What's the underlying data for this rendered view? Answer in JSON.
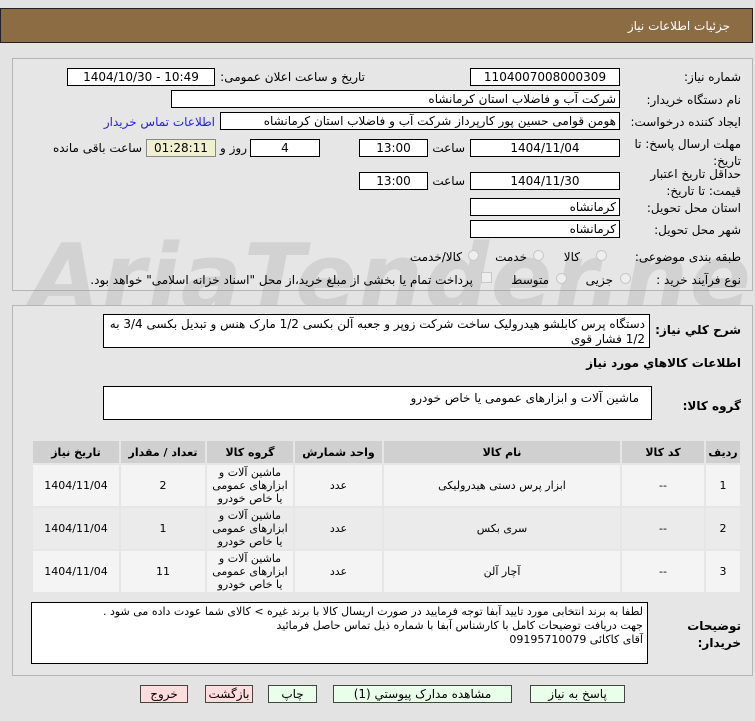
{
  "header": {
    "title": "جزئیات اطلاعات نیاز"
  },
  "watermark": "AriaTender.net",
  "fields": {
    "need_number_label": "شماره نیاز:",
    "need_number": "1104007008000309",
    "announce_label": "تاریخ و ساعت اعلان عمومی:",
    "announce_value": "1404/10/30 - 10:49",
    "buyer_label": "نام دستگاه خریدار:",
    "buyer_value": "شرکت آب و فاضلاب استان کرمانشاه",
    "creator_label": "ایجاد کننده درخواست:",
    "creator_value": "هومن قوامی حسین پور کارپرداز شرکت آب و فاضلاب استان کرمانشاه",
    "contact_link": "اطلاعات تماس خریدار",
    "deadline_label": "مهلت ارسال پاسخ: تا تاریخ:",
    "deadline_date": "1404/11/04",
    "time_label": "ساعت",
    "deadline_time": "13:00",
    "days": "4",
    "days_label": "روز و",
    "remaining": "01:28:11",
    "remaining_label": "ساعت باقی مانده",
    "validity_label": "حداقل تاریخ اعتبار قیمت: تا تاریخ:",
    "validity_date": "1404/11/30",
    "validity_time": "13:00",
    "province_label": "استان محل تحویل:",
    "province": "کرمانشاه",
    "city_label": "شهر محل تحویل:",
    "city": "کرمانشاه",
    "category_label": "طبقه بندی موضوعی:",
    "category_options": [
      "کالا",
      "خدمت",
      "کالا/خدمت"
    ],
    "purchase_label": "نوع فرآیند خرید :",
    "purchase_options": [
      "جزیی",
      "متوسط"
    ],
    "payment_note": "پرداخت تمام یا بخشی از مبلغ خرید،از محل \"اسناد خزانه اسلامی\" خواهد بود."
  },
  "details": {
    "desc_label": "شرح کلي نياز:",
    "desc": "دستگاه پرس کابلشو هیدرولیک ساخت شرکت زوپر  و جعبه آلن بکسی 1/2 مارک هنس و تبدیل بکسی 3/4 به 1/2 فشار قوی",
    "goods_heading": "اطلاعات کالاهاي مورد نياز",
    "group_label": "گروه کالا:",
    "group": "ماشین آلات و ابزارهای عمومی یا خاص خودرو"
  },
  "table": {
    "headers": [
      "ردیف",
      "کد کالا",
      "نام کالا",
      "واحد شمارش",
      "گروه کالا",
      "تعداد / مقدار",
      "تاریخ نیاز"
    ],
    "rows": [
      [
        "1",
        "--",
        "ابزار پرس دستی هیدرولیکی",
        "عدد",
        "ماشین آلات و ابزارهای عمومی یا خاص خودرو",
        "2",
        "1404/11/04"
      ],
      [
        "2",
        "--",
        "سری بکس",
        "عدد",
        "ماشین آلات و ابزارهای عمومی یا خاص خودرو",
        "1",
        "1404/11/04"
      ],
      [
        "3",
        "--",
        "آچار آلن",
        "عدد",
        "ماشین آلات و ابزارهای عمومی یا خاص خودرو",
        "11",
        "1404/11/04"
      ]
    ]
  },
  "notes": {
    "label": "توضیحات خریدار:",
    "lines": [
      "لطفا به برند انتخابی مورد تایید آبفا توجه فرمایید در صورت اریسال کالا با برند غیره > کالای شما عودت داده می شود .",
      "جهت دریافت توضیحات کامل با کارشناس آبفا با شماره ذیل تماس حاصل فرمائید",
      "آقای کاکائی 09195710079"
    ]
  },
  "buttons": {
    "reply": "پاسخ به نیاز",
    "attachments": "مشاهده مدارک پیوستي (1)",
    "print": "چاپ",
    "back": "بازگشت",
    "exit": "خروج"
  }
}
